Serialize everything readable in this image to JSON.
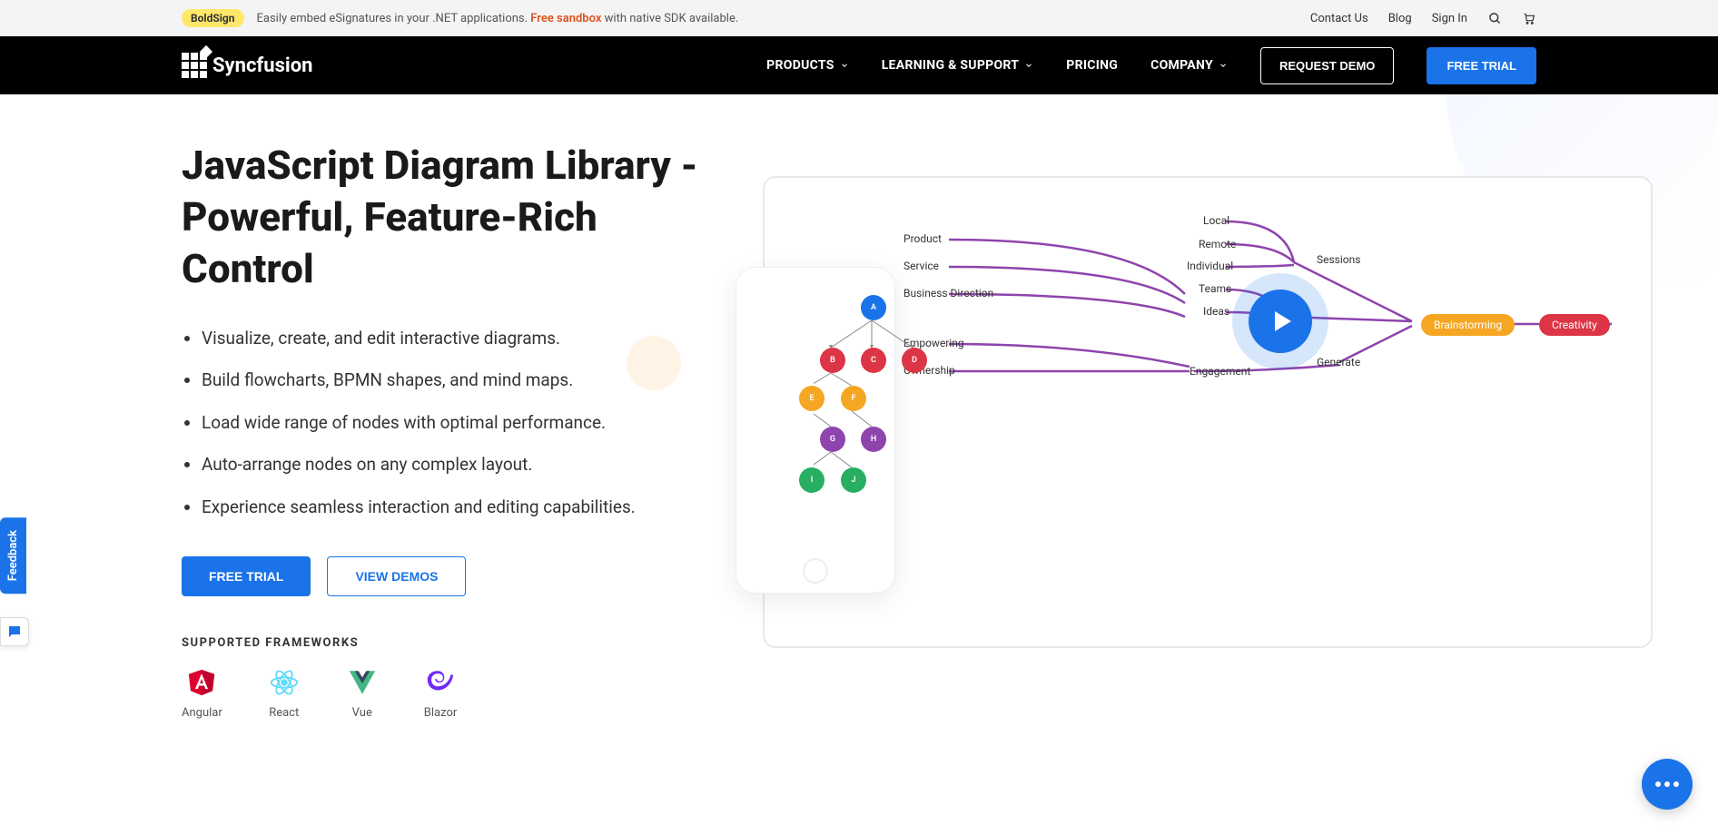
{
  "topbar": {
    "badge": "BoldSign",
    "text_before": "Easily embed eSignatures in your .NET applications. ",
    "text_orange": "Free sandbox",
    "text_after": " with native SDK available.",
    "links": {
      "contact": "Contact Us",
      "blog": "Blog",
      "signin": "Sign In"
    }
  },
  "nav": {
    "brand": "Syncfusion",
    "items": {
      "products": "PRODUCTS",
      "learning": "LEARNING & SUPPORT",
      "pricing": "PRICING",
      "company": "COMPANY"
    },
    "request_demo": "REQUEST DEMO",
    "free_trial": "FREE TRIAL"
  },
  "hero": {
    "title": "JavaScript Diagram Library - Powerful, Feature-Rich Control",
    "bullets": [
      "Visualize, create, and edit interactive diagrams.",
      "Build flowcharts, BPMN shapes, and mind maps.",
      "Load wide range of nodes with optimal performance.",
      "Auto-arrange nodes on any complex layout.",
      "Experience seamless interaction and editing capabilities."
    ],
    "cta_primary": "FREE TRIAL",
    "cta_secondary": "VIEW DEMOS",
    "frameworks_label": "SUPPORTED FRAMEWORKS",
    "frameworks": {
      "angular": "Angular",
      "react": "React",
      "vue": "Vue",
      "blazor": "Blazor"
    }
  },
  "illustration": {
    "tree_nodes": {
      "A": "A",
      "B": "B",
      "C": "C",
      "D": "D",
      "E": "E",
      "F": "F",
      "G": "G",
      "H": "H",
      "I": "I",
      "J": "J"
    },
    "mindmap": {
      "col1": [
        "Product",
        "Service",
        "Business Direction",
        "Empowering",
        "Ownership"
      ],
      "col2": [
        "Local",
        "Remote",
        "Individual",
        "Teams",
        "Ideas"
      ],
      "col3": [
        "Sessions",
        "Generate",
        "Engagement"
      ],
      "brainstorming": "Brainstorming",
      "creativity": "Creativity"
    }
  },
  "feedback": "Feedback"
}
